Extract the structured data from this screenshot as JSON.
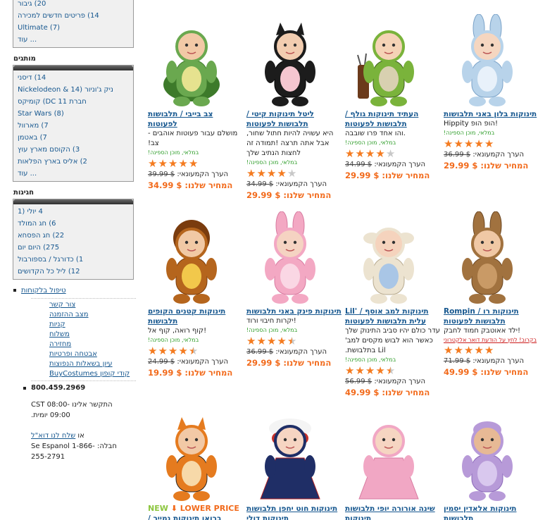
{
  "sidebar": {
    "top_box": {
      "items": [
        "20) גיבור",
        "14) פריטים חדשים למכירה",
        "Ultimate (7)"
      ],
      "more": "עוד ..."
    },
    "licensed": {
      "title": "מותגים",
      "items": [
        "14) דיסני",
        "Nickelodeon & 14) ניק ג'וניור",
        "חברת DC 11) קומיקס",
        "Star Wars (8)",
        "7) מארוול",
        "7) באטמן",
        "3) הקוסם מארץ עוץ",
        "2) אליס בארץ הפלאות"
      ],
      "more": "עוד ..."
    },
    "holidays": {
      "title": "חגיגות",
      "items": [
        "4 יולי (1",
        "6) חג המולד",
        "22) חג הפסחא",
        "275) היום יום",
        "1) כדורגל / בספורבול",
        "12) ליל כל הקדושים"
      ]
    },
    "service": {
      "title": "טיפול בלקוחות",
      "links": [
        "צור קשר",
        "מצב ההזמנה",
        "קניות",
        "משלוח",
        "מחזירה",
        "אבטחה ופרטיות",
        "עיון בשאלות הנפוצות",
        "קודי קופון BuyCostumes"
      ],
      "phone": "800.459.2969",
      "hours": "התקשר אלינו CST 08:00-09:00 יומית.",
      "email_prefix": "או",
      "email_link": "שלח לנו דוא\"ל",
      "espanol": "Se Espanol  חבלה: 1-866-255-2791"
    }
  },
  "products": [
    {
      "name": "צב בייבי / תלבושות לפעוטות",
      "desc": "מושלם עבור פעוטות אוהבים -צב!",
      "ship": "במלאי, מוכן הספינה!",
      "stars": 5,
      "list_label": "הערך הקמעונאי:",
      "list_price": "39.99 $",
      "our_label": "המחיר שלנו:",
      "our_price": "34.99 $",
      "img": "turtle"
    },
    {
      "name": "ליטל תינוקות קיטי / תלבושות לפעוטות",
      "desc": "היא עשויה להיות חתול שחור, אבל אתה תרצה !תמודה זה לחצות הנתיב שלך",
      "ship": "במלאי, מוכן הספינה!",
      "stars": 4,
      "list_label": "הערך הקמעונאי:",
      "list_price": "34.99 $",
      "our_label": "המחיר שלנו:",
      "our_price": "29.99 $",
      "img": "kitty"
    },
    {
      "name": "העתיד תינוקות גולף / תלבושות לפעוטות",
      "desc": ".והו אחד פרו שובבה",
      "ship": "במלאי, מוכן הספינה!",
      "stars": 4,
      "list_label": "הערך הקמעונאי:",
      "list_price": "34.99 $",
      "our_label": "המחיר שלנו:",
      "our_price": "29.99 $",
      "img": "golf"
    },
    {
      "name": "תינוקות בלון באני תלבושות",
      "desc": "Hippity הופ הופ!",
      "ship": "במלאי, מוכן הספינה!",
      "stars": 5,
      "list_label": "הערך הקמעונאי:",
      "list_price": "36.99 $",
      "our_label": "המחיר שלנו:",
      "our_price": "29.99 $",
      "img": "bunny"
    },
    {
      "name": "תינוקות קטנים הקופים תלבושות",
      "desc": "!קוף רואה, קוף אל",
      "ship": "במלאי, מוכן הספינה!",
      "stars": 4.5,
      "list_label": "הערך הקמעונאי:",
      "list_price": "24.99 $",
      "our_label": "המחיר שלנו:",
      "our_price": "19.99 $",
      "img": "monkey"
    },
    {
      "name": "תינוקות פינק באני תלבושות",
      "desc": "!יקרות חיבוי ורוד",
      "ship": "במלאי, מוכן הספינה!",
      "stars": 4.5,
      "list_label": "הערך הקמעונאי:",
      "list_price": "36.99 $",
      "our_label": "המחיר שלנו:",
      "our_price": "29.99 $",
      "img": "pinkbunny"
    },
    {
      "name": "Lil' תינוקות למב אוסף / עלית תלבושות לפעוטות",
      "desc": "עדר כולם יהיו סביב התינוק שלך כאשר הוא לבוש מקסים למב' Lil בתלבושת.",
      "ship": "במלאי, מוכן הספינה!",
      "stars": 4.5,
      "list_label": "הערך הקמעונאי:",
      "list_price": "56.99 $",
      "our_label": "המחיר שלנו:",
      "our_price": "49.99 $",
      "img": "lamb"
    },
    {
      "name": "Rompin / תינוקות רו תלבושות לפעוטות",
      "desc": "!ילד אאוטבק חמוד לחבק",
      "warn": "בקרוב! לחץ על הודעת דואר אלקטרוני",
      "stars": 5,
      "list_label": "הערך הקמעונאי:",
      "list_price": "71.99 $",
      "our_label": "המחיר שלנו:",
      "our_price": "49.99 $",
      "img": "kangaroo"
    },
    {
      "badge_new": "NEW",
      "badge_lower": "LOWER PRICE",
      "name": "ברואו תינוקות נמייר /",
      "img": "tiger"
    },
    {
      "name": "תינוקות חוט יחפן תלבושות",
      "name2": "תינוקות דולי",
      "img": "doll"
    },
    {
      "name": "שינה אורורה יופי תלבושות",
      "name2": "תינוקות",
      "img": "aurora"
    },
    {
      "name": "תינוקות אלאדין יסמין",
      "name2": "תלבושות",
      "img": "jasmine"
    }
  ]
}
